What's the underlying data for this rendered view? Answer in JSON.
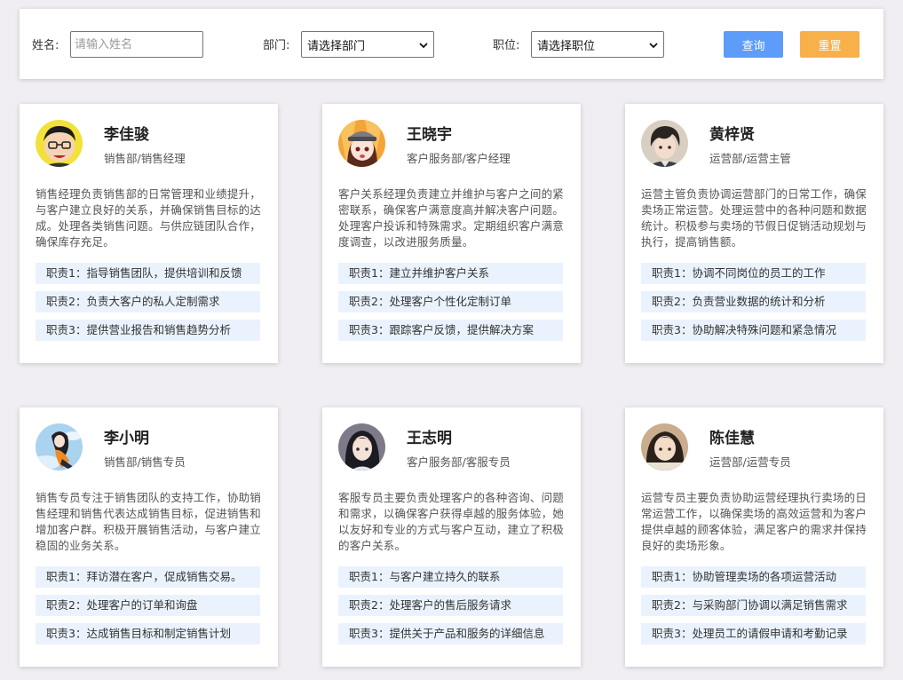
{
  "search": {
    "name_label": "姓名:",
    "name_placeholder": "请输入姓名",
    "name_value": "",
    "dept_label": "部门:",
    "dept_selected": "请选择部门",
    "position_label": "职位:",
    "position_selected": "请选择职位",
    "query_button": "查询",
    "reset_button": "重置",
    "query_color": "#5d9cf8",
    "reset_color": "#f8b04a"
  },
  "cards": [
    {
      "name": "李佳骏",
      "dept": "销售部/销售经理",
      "avatar": "avatar-cartoon-man",
      "desc": "销售经理负责销售部的日常管理和业绩提升，与客户建立良好的关系，并确保销售目标的达成。处理各类销售问题。与供应链团队合作，确保库存充足。",
      "duties": [
        "职责1：指导销售团队，提供培训和反馈",
        "职责2：负责大客户的私人定制需求",
        "职责3：提供营业报告和销售趋势分析"
      ]
    },
    {
      "name": "王晓宇",
      "dept": "客户服务部/客户经理",
      "avatar": "avatar-anime-girl-cap",
      "desc": "客户关系经理负责建立并维护与客户之间的紧密联系，确保客户满意度高并解决客户问题。处理客户投诉和特殊需求。定期组织客户满意度调查，以改进服务质量。",
      "duties": [
        "职责1：建立并维护客户关系",
        "职责2：处理客户个性化定制订单",
        "职责3：跟踪客户反馈，提供解决方案"
      ]
    },
    {
      "name": "黄梓贤",
      "dept": "运营部/运营主管",
      "avatar": "avatar-anime-boy",
      "desc": "运营主管负责协调运营部门的日常工作，确保卖场正常运营。处理运营中的各种问题和数据统计。积极参与卖场的节假日促销活动规划与执行，提高销售额。",
      "duties": [
        "职责1：协调不同岗位的员工的工作",
        "职责2：负责营业数据的统计和分析",
        "职责3：协助解决特殊问题和紧急情况"
      ]
    },
    {
      "name": "李小明",
      "dept": "销售部/销售专员",
      "avatar": "avatar-anime-girl-sky",
      "desc": "销售专员专注于销售团队的支持工作，协助销售经理和销售代表达成销售目标，促进销售和增加客户群。积极开展销售活动，与客户建立稳固的业务关系。",
      "duties": [
        "职责1：拜访潜在客户，促成销售交易。",
        "职责2：处理客户的订单和询盘",
        "职责3：达成销售目标和制定销售计划"
      ]
    },
    {
      "name": "王志明",
      "dept": "客户服务部/客服专员",
      "avatar": "avatar-anime-girl-longhair",
      "desc": "客服专员主要负责处理客户的各种咨询、问题和需求，以确保客户获得卓越的服务体验，她以友好和专业的方式与客户互动，建立了积极的客户关系。",
      "duties": [
        "职责1：与客户建立持久的联系",
        "职责2：处理客户的售后服务请求",
        "职责3：提供关于产品和服务的详细信息"
      ]
    },
    {
      "name": "陈佳慧",
      "dept": "运营部/运营专员",
      "avatar": "avatar-anime-girl-brown",
      "desc": "运营专员主要负责协助运营经理执行卖场的日常运营工作，以确保卖场的高效运营和为客户提供卓越的顾客体验，满足客户的需求并保持良好的卖场形象。",
      "duties": [
        "职责1：协助管理卖场的各项运营活动",
        "职责2：与采购部门协调以满足销售需求",
        "职责3：处理员工的请假申请和考勤记录"
      ]
    }
  ]
}
